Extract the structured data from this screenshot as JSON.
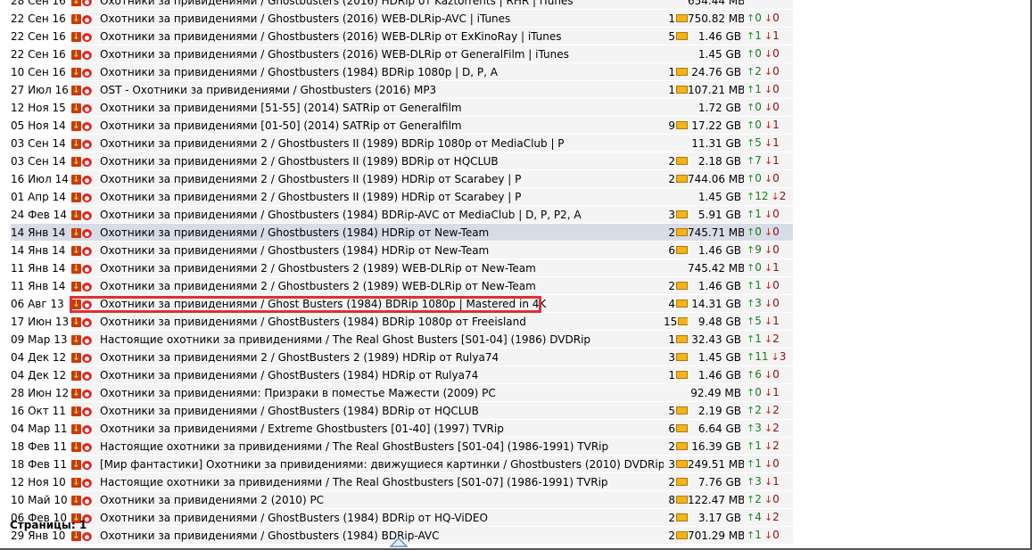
{
  "footer": {
    "pages_label": "Страницы: 1"
  },
  "torrents": [
    {
      "date": "28 Сен 16",
      "title": "Охотники за привидениями / Ghostbusters (2016) HDRip от Kaztorrents | RHR | iTunes",
      "comments": "",
      "size": "654.44 MB",
      "seeds": "",
      "leech": ""
    },
    {
      "date": "22 Сен 16",
      "title": "Охотники за привидениями / Ghostbusters (2016) WEB-DLRip-AVC | iTunes",
      "comments": "1",
      "size": "750.82 MB",
      "seeds": "0",
      "leech": "0"
    },
    {
      "date": "22 Сен 16",
      "title": "Охотники за привидениями / Ghostbusters (2016) WEB-DLRip от ExKinoRay | iTunes",
      "comments": "5",
      "size": "1.46 GB",
      "seeds": "1",
      "leech": "1"
    },
    {
      "date": "22 Сен 16",
      "title": "Охотники за привидениями / Ghostbusters (2016) WEB-DLRip от GeneralFilm | iTunes",
      "comments": "",
      "size": "1.45 GB",
      "seeds": "0",
      "leech": "0"
    },
    {
      "date": "10 Сен 16",
      "title": "Охотники за привидениями / Ghostbusters (1984) BDRip 1080p | D, P, A",
      "comments": "1",
      "size": "24.76 GB",
      "seeds": "2",
      "leech": "0"
    },
    {
      "date": "27 Июл 16",
      "title": "OST - Охотники за привидениями / Ghostbusters (2016) MP3",
      "comments": "1",
      "size": "107.21 MB",
      "seeds": "1",
      "leech": "0"
    },
    {
      "date": "12 Ноя 15",
      "title": "Охотники за привидениями [51-55] (2014) SATRip от Generalfilm",
      "comments": "",
      "size": "1.72 GB",
      "seeds": "0",
      "leech": "0"
    },
    {
      "date": "05 Ноя 14",
      "title": "Охотники за привидениями [01-50] (2014) SATRip от Generalfilm",
      "comments": "9",
      "size": "17.22 GB",
      "seeds": "0",
      "leech": "1"
    },
    {
      "date": "03 Сен 14",
      "title": "Охотники за привидениями 2 / Ghostbusters II (1989) BDRip 1080p от MediaClub | P",
      "comments": "",
      "size": "11.31 GB",
      "seeds": "5",
      "leech": "1"
    },
    {
      "date": "03 Сен 14",
      "title": "Охотники за привидениями 2 / Ghostbusters II (1989) BDRip от HQCLUB",
      "comments": "2",
      "size": "2.18 GB",
      "seeds": "7",
      "leech": "1"
    },
    {
      "date": "16 Июл 14",
      "title": "Охотники за привидениями 2 / Ghostbusters II (1989) HDRip от Scarabey | P",
      "comments": "2",
      "size": "744.06 MB",
      "seeds": "0",
      "leech": "0"
    },
    {
      "date": "01 Апр 14",
      "title": "Охотники за привидениями 2 / Ghostbusters II (1989) HDRip от Scarabey | P",
      "comments": "",
      "size": "1.45 GB",
      "seeds": "12",
      "leech": "2"
    },
    {
      "date": "24 Фев 14",
      "title": "Охотники за привидениями / Ghostbusters (1984) BDRip-AVC от MediaClub | D, P, P2, A",
      "comments": "3",
      "size": "5.91 GB",
      "seeds": "1",
      "leech": "0"
    },
    {
      "date": "14 Янв 14",
      "title": "Охотники за привидениями / Ghostbusters (1984) HDRip от New-Team",
      "comments": "2",
      "size": "745.71 MB",
      "seeds": "0",
      "leech": "0",
      "highlighted": true
    },
    {
      "date": "14 Янв 14",
      "title": "Охотники за привидениями / Ghostbusters (1984) HDRip от New-Team",
      "comments": "6",
      "size": "1.46 GB",
      "seeds": "9",
      "leech": "0"
    },
    {
      "date": "11 Янв 14",
      "title": "Охотники за привидениями 2 / Ghostbusters 2 (1989) WEB-DLRip от New-Team",
      "comments": "",
      "size": "745.42 MB",
      "seeds": "0",
      "leech": "1"
    },
    {
      "date": "11 Янв 14",
      "title": "Охотники за привидениями 2 / Ghostbusters 2 (1989) WEB-DLRip от New-Team",
      "comments": "2",
      "size": "1.46 GB",
      "seeds": "1",
      "leech": "0"
    },
    {
      "date": "06 Авг 13",
      "title": "Охотники за привидениями / Ghost Busters (1984) BDRip 1080p | Mastered in 4K",
      "comments": "4",
      "size": "14.31 GB",
      "seeds": "3",
      "leech": "0"
    },
    {
      "date": "17 Июн 13",
      "title": "Охотники за привидениями / GhostBusters (1984) BDRip 1080p от Freeisland",
      "comments": "15",
      "size": "9.48 GB",
      "seeds": "5",
      "leech": "1"
    },
    {
      "date": "09 Мар 13",
      "title": "Настоящие охотники за привидениями / The Real Ghost Busters [S01-04] (1986) DVDRip",
      "comments": "1",
      "size": "32.43 GB",
      "seeds": "1",
      "leech": "2"
    },
    {
      "date": "04 Дек 12",
      "title": "Охотники за привидениями 2 / GhostBusters 2 (1989) HDRip от Rulya74",
      "comments": "3",
      "size": "1.45 GB",
      "seeds": "11",
      "leech": "3"
    },
    {
      "date": "04 Дек 12",
      "title": "Охотники за привидениями / GhostBusters (1984) HDRip от Rulya74",
      "comments": "1",
      "size": "1.46 GB",
      "seeds": "6",
      "leech": "0"
    },
    {
      "date": "28 Июн 12",
      "title": "Охотники за привидениями: Призраки в поместье Мажести (2009) PC",
      "comments": "",
      "size": "92.49 MB",
      "seeds": "0",
      "leech": "1"
    },
    {
      "date": "16 Окт 11",
      "title": "Охотники за привидениями / GhostBusters (1984) BDRip от HQCLUB",
      "comments": "5",
      "size": "2.19 GB",
      "seeds": "2",
      "leech": "2"
    },
    {
      "date": "04 Мар 11",
      "title": "Охотники за привидениями / Extreme Ghostbusters [01-40] (1997) TVRip",
      "comments": "6",
      "size": "6.64 GB",
      "seeds": "3",
      "leech": "2"
    },
    {
      "date": "18 Фев 11",
      "title": "Настоящие охотники за привидениями / The Real GhostBusters [S01-04] (1986-1991) TVRip",
      "comments": "2",
      "size": "16.39 GB",
      "seeds": "1",
      "leech": "2"
    },
    {
      "date": "18 Фев 11",
      "title": "[Мир фантастики] Охотники за привидениями: движущиеся картинки / Ghostbusters (2010) DVDRip",
      "comments": "3",
      "size": "249.51 MB",
      "seeds": "1",
      "leech": "0"
    },
    {
      "date": "12 Ноя 10",
      "title": "Настоящие охотники за привидениями / The Real Ghostbusters [S01-07] (1986-1991) TVRip",
      "comments": "2",
      "size": "7.76 GB",
      "seeds": "3",
      "leech": "1"
    },
    {
      "date": "10 Май 10",
      "title": "Охотники за привидениями 2 (2010) PC",
      "comments": "8",
      "size": "122.47 MB",
      "seeds": "2",
      "leech": "0"
    },
    {
      "date": "06 Фев 10",
      "title": "Охотники за привидениями / GhostBusters (1984) BDRip от HQ-ViDEO",
      "comments": "2",
      "size": "3.17 GB",
      "seeds": "4",
      "leech": "2"
    },
    {
      "date": "29 Янв 10",
      "title": "Охотники за привидениями / Ghostbusters (1984) BDRip-AVC",
      "comments": "2",
      "size": "701.29 MB",
      "seeds": "1",
      "leech": "0"
    }
  ]
}
